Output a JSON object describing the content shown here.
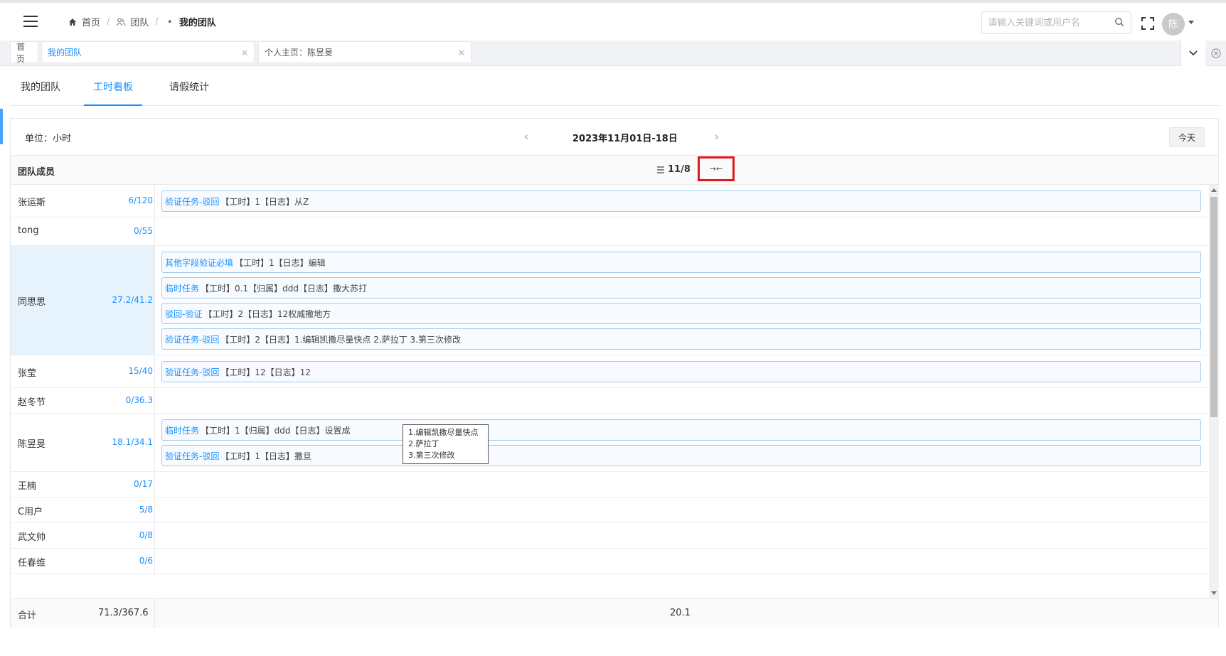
{
  "breadcrumb": {
    "home": "首页",
    "team": "团队",
    "current": "我的团队"
  },
  "search": {
    "placeholder": "请输入关键词或用户名"
  },
  "user": {
    "avatar_text": "陈"
  },
  "visited_tabs": {
    "home": "首页",
    "my_team": "我的团队",
    "profile": "个人主页：陈昱旻",
    "close": "×"
  },
  "sub_tabs": [
    "我的团队",
    "工时看板",
    "请假统计"
  ],
  "board": {
    "unit_label": "单位：小时",
    "date_range": "2023年11月01日-18日",
    "prev": "‹",
    "next": "›",
    "today_label": "今天",
    "members_header": "团队成员",
    "day_header": "11/8",
    "collapse_glyph": "→←"
  },
  "members": [
    {
      "name": "张运斯",
      "hours": "6/120",
      "entries": [
        {
          "task": "验证任务-驳回",
          "text": "【工时】1【日志】从Z"
        }
      ]
    },
    {
      "name": "tong",
      "hours": "0/55",
      "entries": []
    },
    {
      "name": "同思思",
      "hours": "27.2/41.2",
      "entries": [
        {
          "task": "其他字段验证必填",
          "text": "【工时】1【日志】编辑"
        },
        {
          "task": "临时任务",
          "text": "【工时】0.1【归属】ddd【日志】撒大苏打"
        },
        {
          "task": "驳回-验证",
          "text": "【工时】2【日志】12权威撒地方"
        },
        {
          "task": "验证任务-驳回",
          "text": "【工时】2【日志】1.编辑凯撒尽量快点 2.萨拉丁 3.第三次修改"
        }
      ]
    },
    {
      "name": "张莹",
      "hours": "15/40",
      "entries": [
        {
          "task": "验证任务-驳回",
          "text": "【工时】12【日志】12"
        }
      ]
    },
    {
      "name": "赵冬节",
      "hours": "0/36.3",
      "entries": []
    },
    {
      "name": "陈昱旻",
      "hours": "18.1/34.1",
      "entries": [
        {
          "task": "临时任务",
          "text": "【工时】1【归属】ddd【日志】设置成"
        },
        {
          "task": "验证任务-驳回",
          "text": "【工时】1【日志】撒旦"
        }
      ]
    },
    {
      "name": "王楠",
      "hours": "0/17",
      "entries": []
    },
    {
      "name": "C用户",
      "hours": "5/8",
      "entries": []
    },
    {
      "name": "武文帅",
      "hours": "0/8",
      "entries": []
    },
    {
      "name": "任春维",
      "hours": "0/6",
      "entries": []
    }
  ],
  "tooltip": {
    "line1": "1.编辑凯撒尽量快点",
    "line2": "2.萨拉丁",
    "line3": "3.第三次修改"
  },
  "totals": {
    "label": "合计",
    "value": "71.3/367.6",
    "day_total": "20.1"
  },
  "colors": {
    "accent": "#1890ff",
    "highlight_row": "#e6f3fd",
    "annotation": "#e0181e"
  }
}
